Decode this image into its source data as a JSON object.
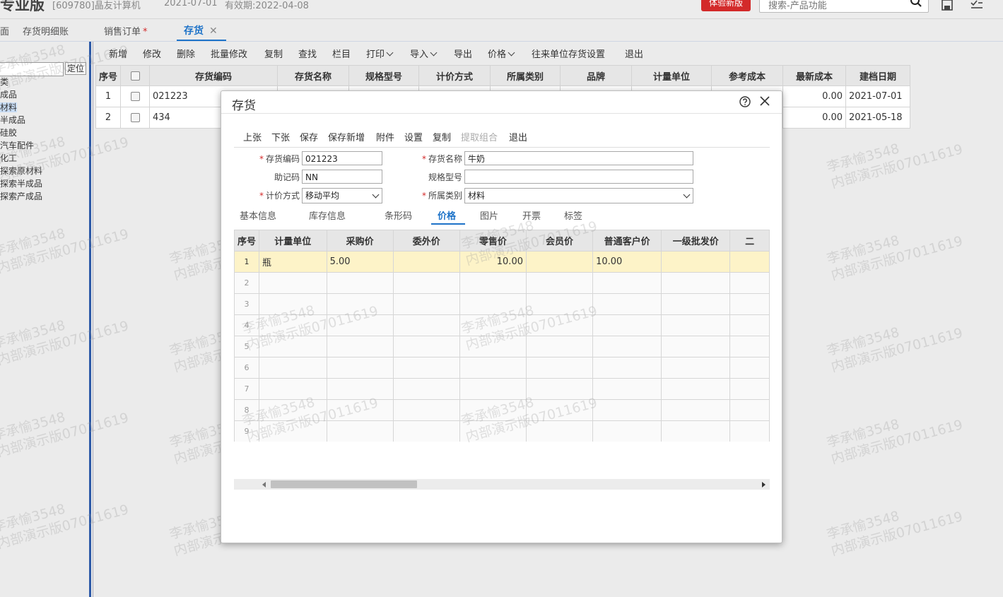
{
  "header": {
    "brand": "专业版",
    "company": "[609780]晶友计算机",
    "date": "2021-07-01",
    "validity": "有效期:2022-04-08",
    "trial_button": "体验新版",
    "search_placeholder": "搜索-产品功能"
  },
  "tabs": [
    {
      "label": "面"
    },
    {
      "label": "存货明细账"
    },
    {
      "label": "销售订单",
      "star": "*"
    },
    {
      "label": "存货"
    }
  ],
  "tree": {
    "locate_button": "定位",
    "items": [
      "类",
      "成品",
      "材料",
      "半成品",
      "硅胶",
      "汽车配件",
      "化工",
      "探索原材料",
      "探索半成品",
      "探索产成品"
    ]
  },
  "toolbar": {
    "items": [
      "新增",
      "修改",
      "删除",
      "批量修改",
      "复制",
      "查找",
      "栏目",
      "打印",
      "导入",
      "导出",
      "价格",
      "往来单位存货设置",
      "退出"
    ]
  },
  "main_grid": {
    "columns": [
      "序号",
      "",
      "存货编码",
      "存货名称",
      "规格型号",
      "计价方式",
      "所属类别",
      "品牌",
      "计量单位",
      "参考成本",
      "最新成本",
      "建档日期"
    ],
    "rows": [
      {
        "no": "1",
        "code": "021223",
        "latest_cost": "0.00",
        "date": "2021-07-01"
      },
      {
        "no": "2",
        "code": "434",
        "latest_cost": "0.00",
        "date": "2021-05-18"
      }
    ]
  },
  "watermark": {
    "line1": "李承愉3548",
    "line2": "内部演示版07011619"
  },
  "dialog": {
    "title": "存货",
    "toolbar": [
      "上张",
      "下张",
      "保存",
      "保存新增",
      "附件",
      "设置",
      "复制",
      "提取组合",
      "退出"
    ],
    "fields": {
      "code_label": "存货编码",
      "code_value": "021223",
      "name_label": "存货名称",
      "name_value": "牛奶",
      "mnemonic_label": "助记码",
      "mnemonic_value": "NN",
      "spec_label": "规格型号",
      "spec_value": "",
      "valuation_label": "计价方式",
      "valuation_value": "移动平均",
      "category_label": "所属类别",
      "category_value": "材料"
    },
    "subtabs": [
      "基本信息",
      "库存信息",
      "条形码",
      "价格",
      "图片",
      "开票",
      "标签"
    ],
    "price_grid": {
      "columns": [
        "序号",
        "计量单位",
        "采购价",
        "委外价",
        "零售价",
        "会员价",
        "普通客户价",
        "一级批发价",
        "二"
      ],
      "row1": {
        "no": "1",
        "unit": "瓶",
        "purchase": "5.00",
        "retail": "10.00",
        "normal": "10.00"
      },
      "empty_rows": [
        "2",
        "3",
        "4",
        "5",
        "6",
        "7",
        "8",
        "9"
      ]
    }
  }
}
